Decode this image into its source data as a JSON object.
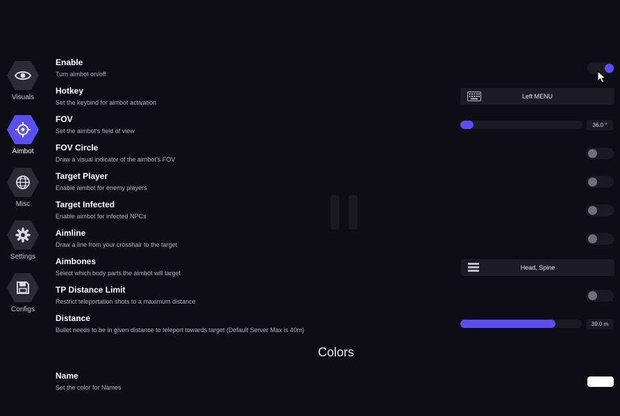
{
  "sidebar": {
    "items": [
      {
        "label": "Visuals",
        "icon": "eye-icon",
        "active": false
      },
      {
        "label": "Aimbot",
        "icon": "crosshair-icon",
        "active": true
      },
      {
        "label": "Misc",
        "icon": "globe-icon",
        "active": false
      },
      {
        "label": "Settings",
        "icon": "gear-icon",
        "active": false
      },
      {
        "label": "Configs",
        "icon": "save-icon",
        "active": false
      }
    ]
  },
  "settings": [
    {
      "title": "Enable",
      "desc": "Turn aimbot on/off",
      "control": "toggle",
      "on": true
    },
    {
      "title": "Hotkey",
      "desc": "Set the keybind for aimbot activation",
      "control": "select",
      "value": "Left MENU",
      "icon": "keyboard-icon"
    },
    {
      "title": "FOV",
      "desc": "Set the aimbot's field of view",
      "control": "slider",
      "value": "36.0 °",
      "fill_fraction": 0.11
    },
    {
      "title": "FOV Circle",
      "desc": "Draw a visual indicator of the aimbot's FOV",
      "control": "toggle",
      "on": false
    },
    {
      "title": "Target Player",
      "desc": "Enable aimbot for enemy players",
      "control": "toggle",
      "on": false
    },
    {
      "title": "Target Infected",
      "desc": "Enable aimbot for infected NPCs",
      "control": "toggle",
      "on": false
    },
    {
      "title": "Aimline",
      "desc": "Draw a line from your crosshair to the target",
      "control": "toggle",
      "on": false
    },
    {
      "title": "Aimbones",
      "desc": "Select which body parts the aimbot will target",
      "control": "select",
      "value": "Head, Spine",
      "icon": "list-icon"
    },
    {
      "title": "TP Distance Limit",
      "desc": "Restrict teleportation shots to a maximum distance",
      "control": "toggle",
      "on": false
    },
    {
      "title": "Distance",
      "desc": "Bullet needs to be in given distance to teleport towards target (Default Server Max is 40m)",
      "control": "slider",
      "value": "39.0 m",
      "fill_fraction": 0.78
    }
  ],
  "colors_section": {
    "title": "Colors",
    "items": [
      {
        "title": "Name",
        "desc": "Set the color for Names",
        "color": "#ffffff"
      }
    ]
  },
  "theme": {
    "accent": "#5a4ff2",
    "background": "#0e0d16",
    "control_bg": "#1b1a24"
  }
}
